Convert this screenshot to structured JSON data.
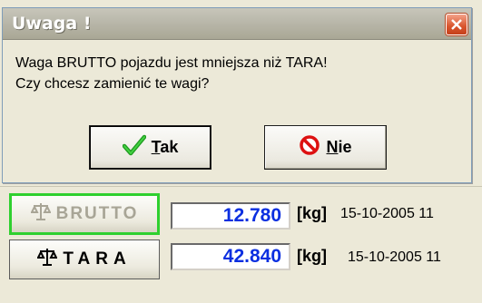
{
  "dialog": {
    "title": "Uwaga !",
    "message_line1": "Waga BRUTTO pojazdu jest mniejsza niż TARA!",
    "message_line2": "Czy chcesz zamienić te wagi?",
    "yes_label": "Tak",
    "no_label": "Nie"
  },
  "form": {
    "brutto": {
      "label": "BRUTTO",
      "value": "12.780",
      "unit": "[kg]",
      "datetime": "15-10-2005 11"
    },
    "tara": {
      "label": "TARA",
      "value": "42.840",
      "unit": "[kg]",
      "datetime": "15-10-2005 11"
    }
  },
  "colors": {
    "accent_value": "#0b2fe0",
    "focus_border": "#2fd02f",
    "close_button": "#d9542c"
  }
}
